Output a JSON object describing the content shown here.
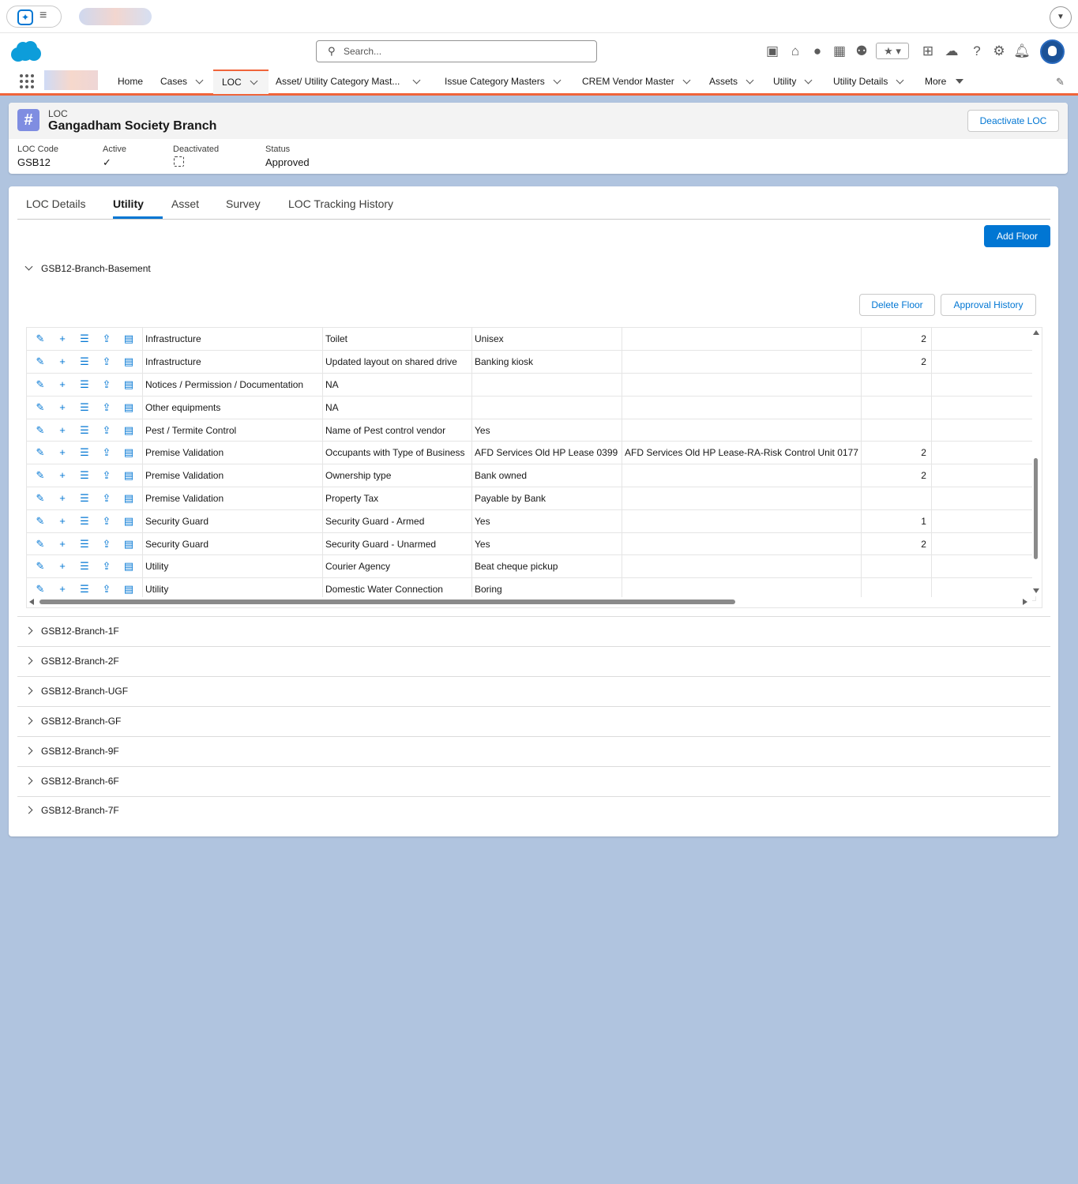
{
  "browser": {
    "menu_icon": "hamburger-icon",
    "spark_icon": "sparkle-icon"
  },
  "header": {
    "search_placeholder": "Search...",
    "icons": [
      "news-icon",
      "home-icon",
      "bear-icon",
      "layout-icon",
      "user-gear-icon",
      "favorites-icon",
      "add-icon",
      "cloud-icon",
      "help-icon",
      "gear-icon",
      "bell-icon"
    ]
  },
  "nav": {
    "items": [
      {
        "label": "Home"
      },
      {
        "label": "Cases"
      },
      {
        "label": "LOC"
      },
      {
        "label": "Asset/ Utility Category Mast..."
      },
      {
        "label": "Issue Category Masters"
      },
      {
        "label": "CREM Vendor Master"
      },
      {
        "label": "Assets"
      },
      {
        "label": "Utility"
      },
      {
        "label": "Utility Details"
      },
      {
        "label": "More"
      }
    ],
    "active": "LOC"
  },
  "record": {
    "object": "LOC",
    "title": "Gangadham Society Branch",
    "deactivate_label": "Deactivate LOC",
    "fields": [
      {
        "label": "LOC Code",
        "value": "GSB12"
      },
      {
        "label": "Active",
        "value": "✓"
      },
      {
        "label": "Deactivated",
        "value": ""
      },
      {
        "label": "Status",
        "value": "Approved"
      }
    ]
  },
  "tabs": [
    "LOC Details",
    "Utility",
    "Asset",
    "Survey",
    "LOC Tracking History"
  ],
  "active_tab": "Utility",
  "add_floor_label": "Add Floor",
  "expanded_floor": {
    "name": "GSB12-Branch-Basement",
    "delete_label": "Delete Floor",
    "approval_label": "Approval History",
    "rows": [
      [
        "Infrastructure",
        "Toilet",
        "Unisex",
        "",
        "2"
      ],
      [
        "Infrastructure",
        "Updated layout on shared drive",
        "Banking kiosk",
        "",
        "2"
      ],
      [
        "Notices / Permission / Documentation",
        "NA",
        "",
        "",
        ""
      ],
      [
        "Other equipments",
        "NA",
        "",
        "",
        ""
      ],
      [
        "Pest / Termite Control",
        "Name of Pest control vendor",
        "Yes",
        "",
        ""
      ],
      [
        "Premise Validation",
        "Occupants with Type of Business",
        "AFD Services Old HP Lease 0399",
        "AFD Services Old HP Lease-RA-Risk Control Unit 0177",
        "2"
      ],
      [
        "Premise Validation",
        "Ownership type",
        "Bank owned",
        "",
        "2"
      ],
      [
        "Premise Validation",
        "Property Tax",
        "Payable by Bank",
        "",
        ""
      ],
      [
        "Security Guard",
        "Security Guard - Armed",
        "Yes",
        "",
        "1"
      ],
      [
        "Security Guard",
        "Security Guard - Unarmed",
        "Yes",
        "",
        "2"
      ],
      [
        "Utility",
        "Courier Agency",
        "Beat cheque pickup",
        "",
        ""
      ],
      [
        "Utility",
        "Domestic Water Connection",
        "Boring",
        "",
        ""
      ]
    ]
  },
  "collapsed_floors": [
    "GSB12-Branch-1F",
    "GSB12-Branch-2F",
    "GSB12-Branch-UGF",
    "GSB12-Branch-GF",
    "GSB12-Branch-9F",
    "GSB12-Branch-6F",
    "GSB12-Branch-7F"
  ],
  "colors": {
    "brand": "#0176d3",
    "nav_accent": "#f0643a",
    "background": "#b0c4df",
    "record_icon": "#7f8de1"
  }
}
